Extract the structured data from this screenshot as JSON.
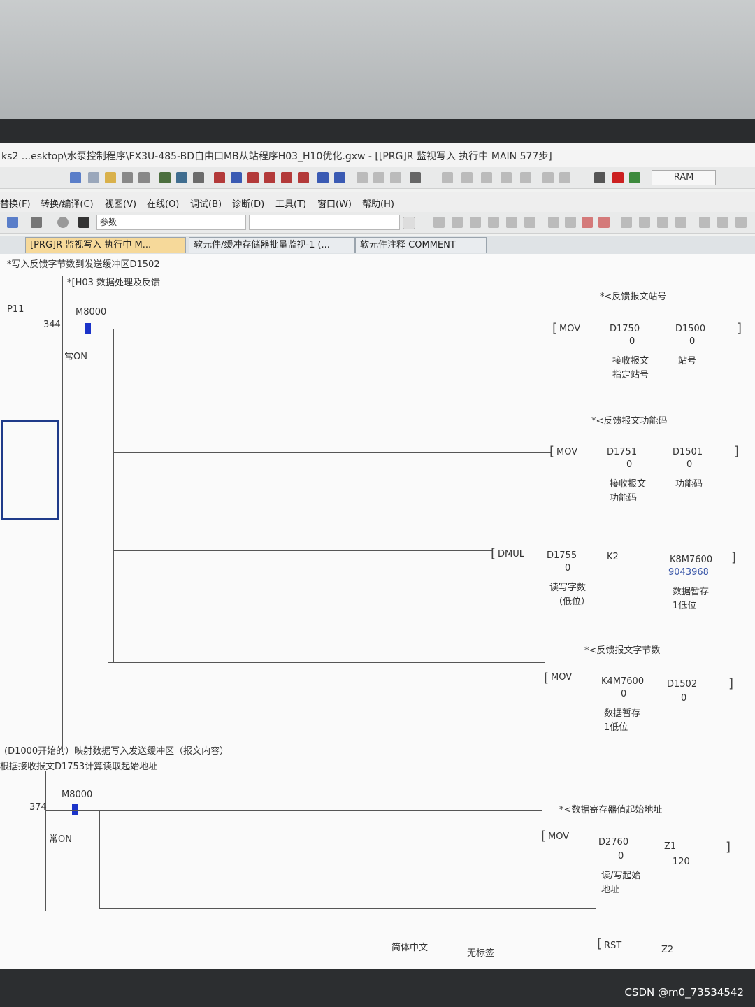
{
  "window": {
    "title": "ks2 ...esktop\\水泵控制程序\\FX3U-485-BD自由口MB从站程序H03_H10优化.gxw - [[PRG]R 监视写入 执行中 MAIN 577步]"
  },
  "toolbar": {
    "ram_label": "RAM",
    "search_value": "参数"
  },
  "menu": [
    "替换(F)",
    "转换/编译(C)",
    "视图(V)",
    "在线(O)",
    "调试(B)",
    "诊断(D)",
    "工具(T)",
    "窗口(W)",
    "帮助(H)"
  ],
  "tabs": [
    {
      "label": "[PRG]R 监视写入 执行中 M..."
    },
    {
      "label": "软元件/缓冲存储器批量监视-1 (..."
    },
    {
      "label": "软元件注释 COMMENT"
    }
  ],
  "ladder": {
    "block1": {
      "comment": "*写入反馈字节数到发送缓冲区D1502",
      "subcomment": "*[H03 数据处理及反馈",
      "pointer": "P11",
      "step": "344",
      "contact": "M8000",
      "contact_comment": "常ON",
      "rungs": [
        {
          "note": "*<反馈报文站号",
          "instr": "MOV",
          "src": "D1750",
          "src_val": "0",
          "src_c1": "接收报文",
          "src_c2": "指定站号",
          "dst": "D1500",
          "dst_val": "0",
          "dst_c1": "站号"
        },
        {
          "note": "*<反馈报文功能码",
          "instr": "MOV",
          "src": "D1751",
          "src_val": "0",
          "src_c1": "接收报文",
          "src_c2": "功能码",
          "dst": "D1501",
          "dst_val": "0",
          "dst_c1": "功能码"
        },
        {
          "instr": "DMUL",
          "src": "D1755",
          "src_val": "0",
          "src_c1": "读写字数",
          "src_c2": "（低位）",
          "mid": "K2",
          "dst": "K8M7600",
          "dst_val": "9043968",
          "dst_c1": "数据暂存",
          "dst_c2": "1低位"
        },
        {
          "note": "*<反馈报文字节数",
          "instr": "MOV",
          "src": "K4M7600",
          "src_val": "0",
          "src_c1": "数据暂存",
          "src_c2": "1低位",
          "dst": "D1502",
          "dst_val": "0"
        }
      ]
    },
    "block2": {
      "comment1": "(D1000开始的）映射数据写入发送缓冲区（报文内容）",
      "comment2": "根据接收报文D1753计算读取起始地址",
      "step": "374",
      "contact": "M8000",
      "contact_comment": "常ON",
      "rung": {
        "note": "*<数据寄存器值起始地址",
        "instr": "MOV",
        "src": "D2760",
        "src_val": "0",
        "src_c1": "读/写起始",
        "src_c2": "地址",
        "dst": "Z1",
        "dst_val": "120"
      },
      "next_instr": "RST",
      "next_arg": "Z2"
    }
  },
  "status": {
    "lang": "简体中文",
    "label": "无标签"
  },
  "watermark": "CSDN @m0_73534542"
}
